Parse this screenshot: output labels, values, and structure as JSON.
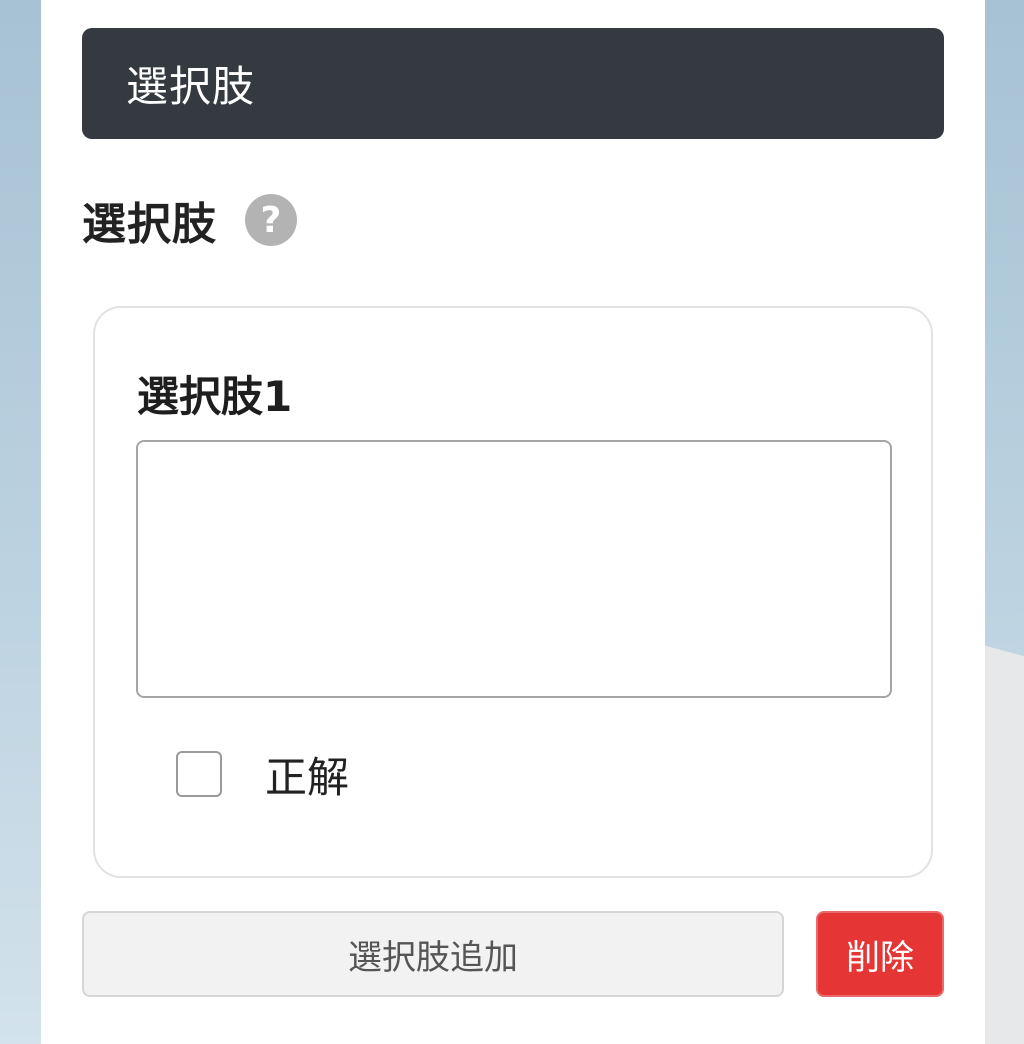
{
  "section_header": {
    "title": "選択肢"
  },
  "field": {
    "label": "選択肢",
    "help_icon_glyph": "?",
    "help_icon": "question-circle-icon"
  },
  "choices": [
    {
      "title": "選択肢1",
      "text_value": "",
      "correct_label": "正解",
      "correct_checked": false
    }
  ],
  "actions": {
    "add_choice_label": "選択肢追加",
    "delete_label": "削除"
  },
  "colors": {
    "header_bg": "#343a40",
    "delete_bg": "#e53535",
    "help_icon_bg": "#b3b3b3"
  }
}
